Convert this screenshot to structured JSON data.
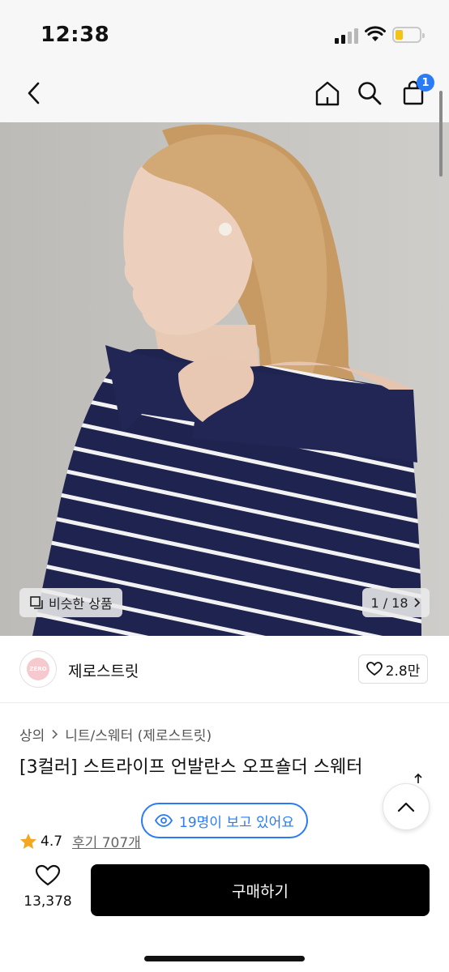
{
  "status": {
    "time": "12:38"
  },
  "nav": {
    "cart_count": "1"
  },
  "gallery": {
    "similar_label": "비슷한 상품",
    "pager": "1 / 18"
  },
  "brand": {
    "logo_text": "ZERO",
    "name": "제로스트릿",
    "likes": "2.8만"
  },
  "product": {
    "breadcrumb": [
      "상의",
      "니트/스웨터 (제로스트릿)"
    ],
    "title": "[3컬러] 스트라이프 언발란스 오프숄더 스웨터",
    "rating": "4.7",
    "reviews": "후기 707개",
    "viewing": "19명이 보고 있어요"
  },
  "bottom": {
    "wish_count": "13,378",
    "buy_label": "구매하기"
  },
  "colors": {
    "accent": "#2a7cf6",
    "star": "#f5a623",
    "buy_bg": "#000000",
    "sweater": "#1f2350"
  }
}
